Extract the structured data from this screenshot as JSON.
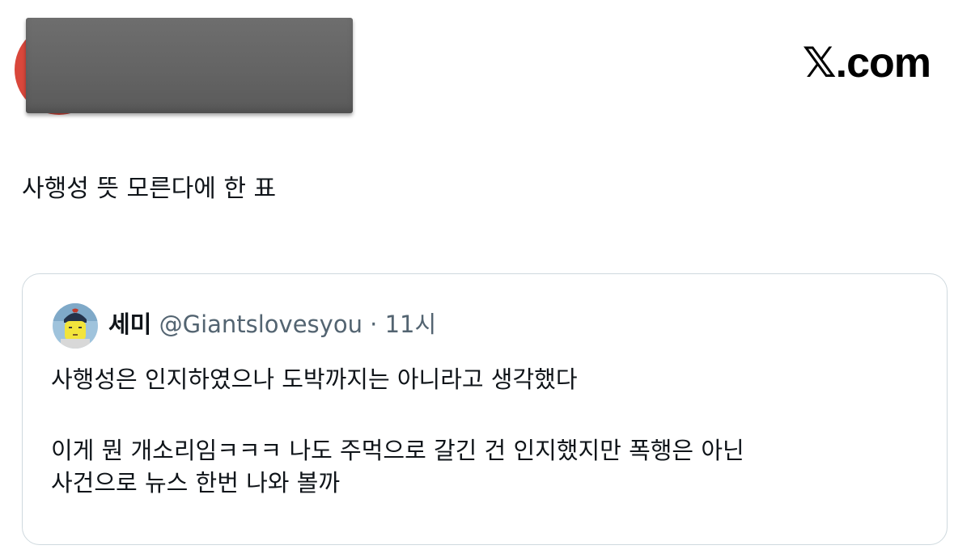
{
  "header": {
    "brand_symbol": "𝕏",
    "brand_suffix": ".com"
  },
  "tweet": {
    "text": "사행성 뜻 모른다에 한 표"
  },
  "quoted_tweet": {
    "author_name": "세미",
    "author_handle": "@Giantslovesyou",
    "separator": "·",
    "time": "11시",
    "lines": [
      "사행성은 인지하였으나 도박까지는 아니라고 생각했다",
      "이게 뭔 개소리임ㅋㅋㅋ 나도 주먹으로 갈긴 건 인지했지만 폭행은 아닌",
      "사건으로 뉴스 한번 나와 볼까"
    ]
  }
}
